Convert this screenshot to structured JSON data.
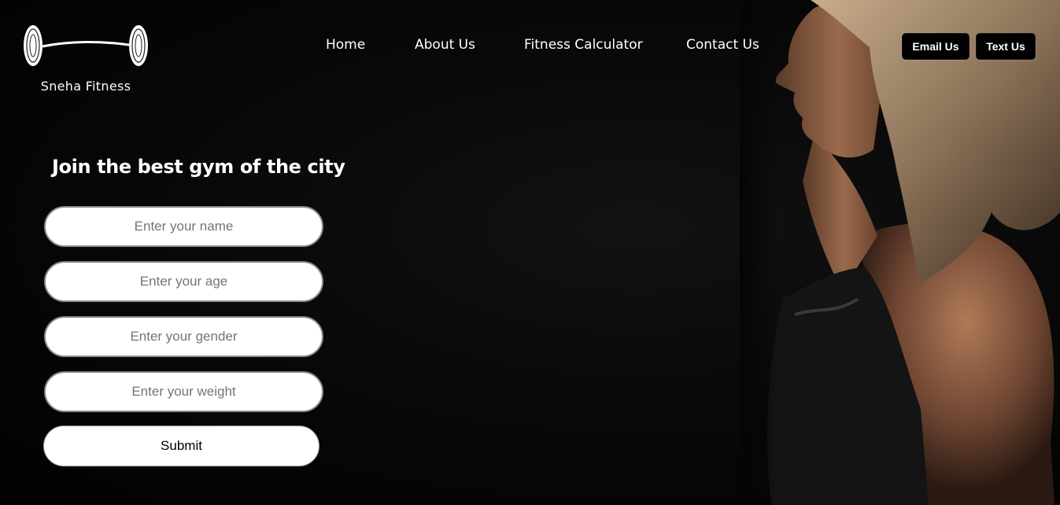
{
  "brand": {
    "name": "Sneha Fitness",
    "logo_icon": "barbell-icon"
  },
  "nav": {
    "items": [
      {
        "label": "Home"
      },
      {
        "label": "About Us"
      },
      {
        "label": "Fitness Calculator"
      },
      {
        "label": "Contact Us"
      }
    ]
  },
  "contact_buttons": {
    "email_label": "Email Us",
    "text_label": "Text Us"
  },
  "form": {
    "title": "Join the best gym of the city",
    "name_placeholder": "Enter your name",
    "age_placeholder": "Enter your age",
    "gender_placeholder": "Enter your gender",
    "weight_placeholder": "Enter your weight",
    "submit_label": "Submit"
  },
  "colors": {
    "background": "#050505",
    "text": "#ffffff",
    "input_background": "#ffffff",
    "button_background": "#000000"
  }
}
